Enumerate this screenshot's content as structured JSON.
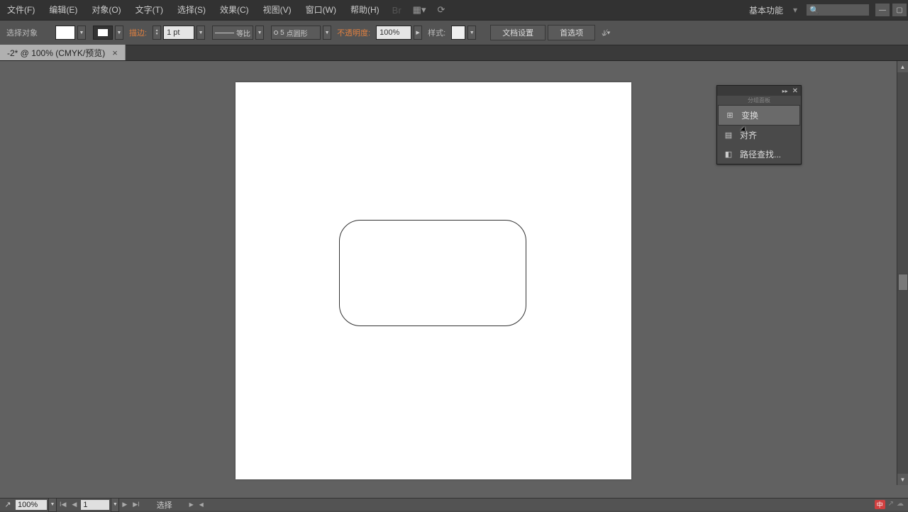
{
  "menu": {
    "file": "文件(F)",
    "edit": "编辑(E)",
    "object": "对象(O)",
    "type": "文字(T)",
    "select": "选择(S)",
    "effect": "效果(C)",
    "view": "视图(V)",
    "window": "窗口(W)",
    "help": "帮助(H)"
  },
  "workspace": {
    "label": "基本功能",
    "arrow": "▾"
  },
  "window_controls": {
    "min": "—",
    "max": "▢"
  },
  "control": {
    "mode_label": "选择对象",
    "stroke_label": "描边:",
    "stroke_weight": "1 pt",
    "stroke_style_label": "等比",
    "profile_value": "5",
    "profile_label": "点圆形",
    "opacity_label": "不透明度:",
    "opacity_value": "100%",
    "style_label": "样式:",
    "doc_setup_btn": "文档设置",
    "prefs_btn": "首选项"
  },
  "tab": {
    "title": "-2* @ 100% (CMYK/预览)",
    "close": "×"
  },
  "panel": {
    "subtitle": "分组面板",
    "transform": "变换",
    "align": "对齐",
    "pathfinder": "路径查找...",
    "collapse": "▸▸",
    "close": "✕"
  },
  "status": {
    "zoom": "100%",
    "page": "1",
    "mode": "选择"
  }
}
